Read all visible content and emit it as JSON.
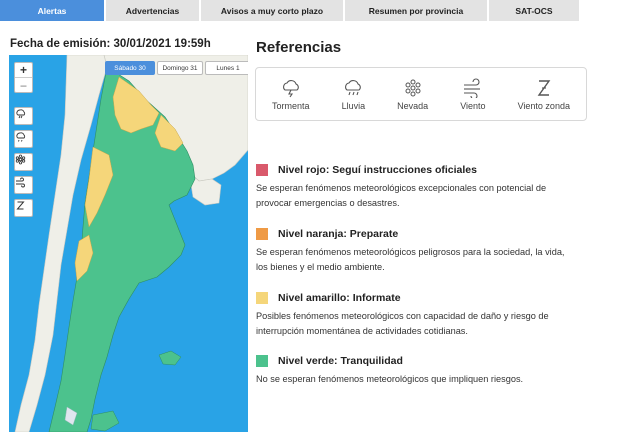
{
  "tabs": [
    {
      "label": "Alertas",
      "active": true
    },
    {
      "label": "Advertencias",
      "active": false
    },
    {
      "label": "Avisos a muy corto plazo",
      "active": false
    },
    {
      "label": "Resumen por provincia",
      "active": false
    },
    {
      "label": "SAT-OCS",
      "active": false
    }
  ],
  "issue_date": "Fecha de emisión: 30/01/2021 19:59h",
  "map": {
    "zoom_in": "+",
    "zoom_out": "−",
    "days": [
      "Sábado 30",
      "Domingo 31",
      "Lunes 1"
    ],
    "active_day": "Sábado 30",
    "colors": {
      "sea": "#29a3e6",
      "land": "#efefe8",
      "green": "#4cc28d",
      "yellow": "#f5d67a"
    }
  },
  "references": {
    "title": "Referencias",
    "icons": [
      {
        "label": "Tormenta",
        "icon": "storm-icon"
      },
      {
        "label": "Lluvia",
        "icon": "rain-icon"
      },
      {
        "label": "Nevada",
        "icon": "snow-icon"
      },
      {
        "label": "Viento",
        "icon": "wind-icon"
      },
      {
        "label": "Viento zonda",
        "icon": "zonda-wind-icon"
      }
    ]
  },
  "levels": [
    {
      "title": "Nivel rojo: Seguí instrucciones oficiales",
      "color": "#d9596b",
      "description": "Se esperan fenómenos meteorológicos excepcionales con potencial de provocar emergencias o desastres."
    },
    {
      "title": "Nivel naranja: Preparate",
      "color": "#ef9a45",
      "description": "Se esperan fenómenos meteorológicos peligrosos para la sociedad, la vida, los bienes y el medio ambiente."
    },
    {
      "title": "Nivel amarillo: Informate",
      "color": "#f5d67a",
      "description": "Posibles fenómenos meteorológicos con capacidad de daño y riesgo de interrupción momentánea de actividades cotidianas."
    },
    {
      "title": "Nivel verde: Tranquilidad",
      "color": "#4cc28d",
      "description": "No se esperan fenómenos meteorológicos que impliquen riesgos."
    }
  ]
}
